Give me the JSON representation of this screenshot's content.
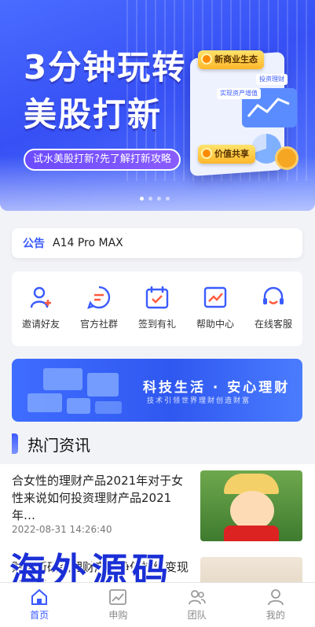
{
  "banner": {
    "title_line1": "3分钟玩转",
    "title_line2": "美股打新",
    "pill": "试水美股打新?先了解打新攻略",
    "tag1": "新商业生态",
    "tag2": "价值共享",
    "mini1": "投资理财",
    "mini2": "实现资产增值",
    "carousel_count": 4,
    "carousel_active": 1
  },
  "notice": {
    "label": "公告",
    "text": "A14 Pro MAX"
  },
  "menu": [
    {
      "label": "邀请好友",
      "icon": "add-user-icon"
    },
    {
      "label": "官方社群",
      "icon": "chat-group-icon"
    },
    {
      "label": "签到有礼",
      "icon": "calendar-check-icon"
    },
    {
      "label": "帮助中心",
      "icon": "chart-trend-icon"
    },
    {
      "label": "在线客服",
      "icon": "headset-icon"
    }
  ],
  "promo": {
    "title": "科技生活 · 安心理财",
    "subtitle": "技术引领世界理财创造财富"
  },
  "news": {
    "heading": "热门资讯",
    "items": [
      {
        "title": "合女性的理财产品2021年对于女性来说如何投资理财产品2021年…",
        "date": "2022-08-31 14:26:40"
      },
      {
        "title": "财富新研究理财产品净值持续变现有哪些",
        "date": ""
      }
    ]
  },
  "watermark": "海外源码",
  "tabbar": [
    {
      "label": "首页",
      "icon": "home-icon",
      "active": true
    },
    {
      "label": "申购",
      "icon": "trend-icon",
      "active": false
    },
    {
      "label": "团队",
      "icon": "team-icon",
      "active": false
    },
    {
      "label": "我的",
      "icon": "user-icon",
      "active": false
    }
  ],
  "colors": {
    "accent": "#3b5bff",
    "banner": "#3650f5",
    "tag": "#ffb72a"
  }
}
